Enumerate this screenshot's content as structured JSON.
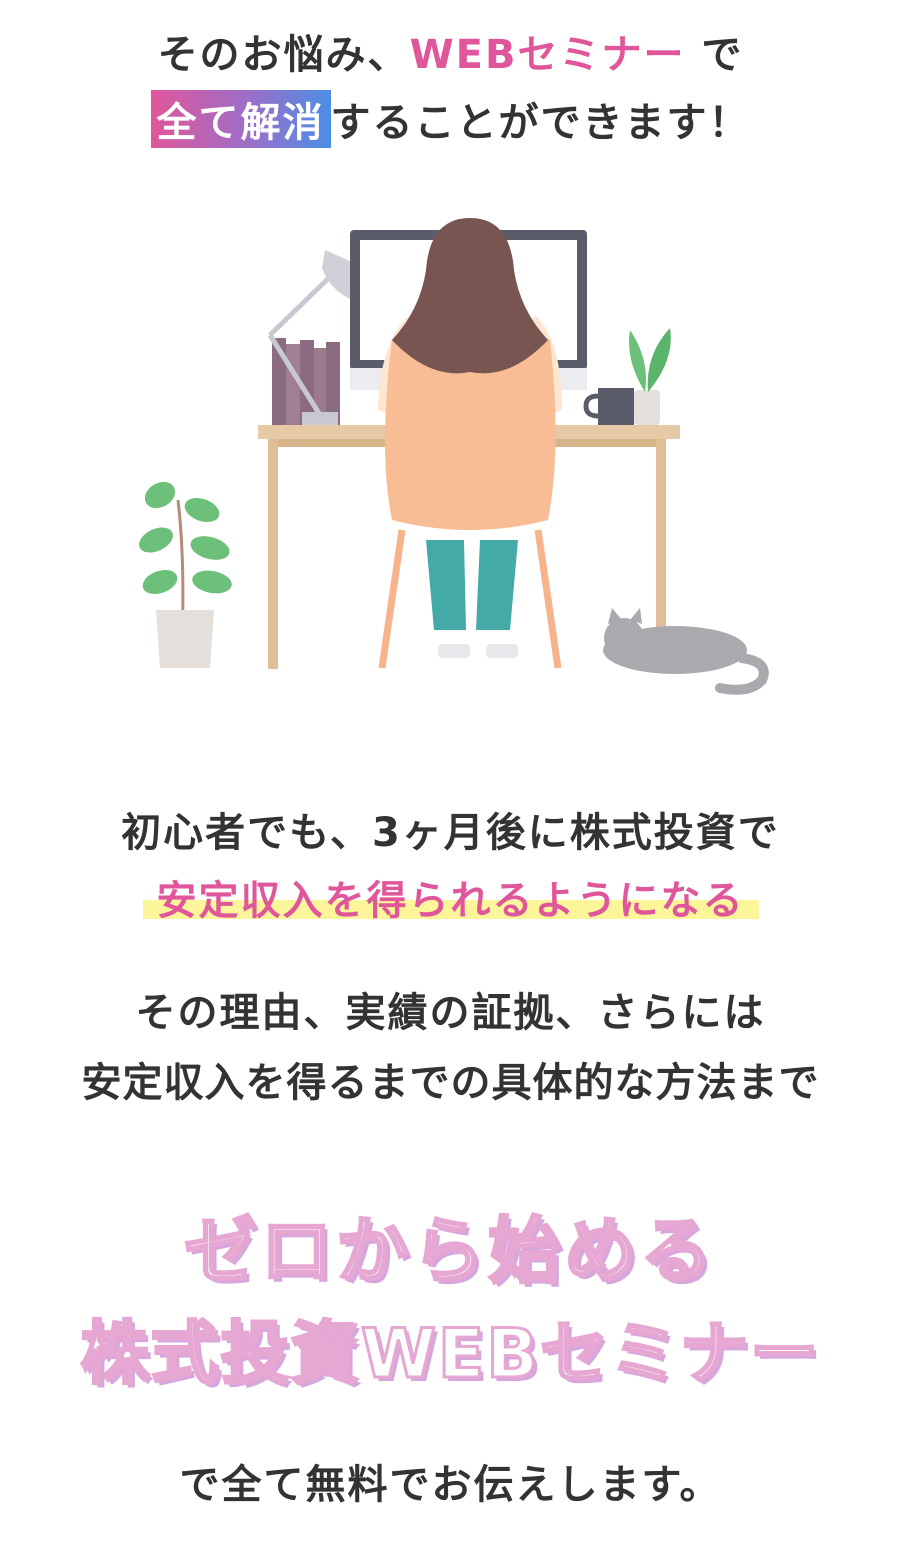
{
  "header": {
    "line1_part1": "そのお悩み、",
    "line1_highlight": "WEBセミナー",
    "line1_part2": " で",
    "line2_badge": "全て解消",
    "line2_rest": "することができます！"
  },
  "illustration": {
    "icons": [
      "woman-at-desk-icon",
      "desk-lamp-icon",
      "books-icon",
      "monitor-icon",
      "mug-icon",
      "potted-plant-icon",
      "cat-icon"
    ]
  },
  "message": {
    "line1": "初心者でも、3ヶ月後に株式投資で",
    "line2": "安定収入を得られるようになる",
    "line3": "その理由、実績の証拠、さらには",
    "line4": "安定収入を得るまでの具体的な方法まで"
  },
  "title": {
    "line1": "ゼロから始める",
    "line2": "株式投資WEBセミナー"
  },
  "footer": {
    "text": "で全て無料でお伝えします。"
  },
  "colors": {
    "pink": "#e0569b",
    "purple": "#9b6fc9",
    "blue": "#4b8ee6",
    "marker_yellow": "#fdf59a",
    "text": "#333333"
  }
}
